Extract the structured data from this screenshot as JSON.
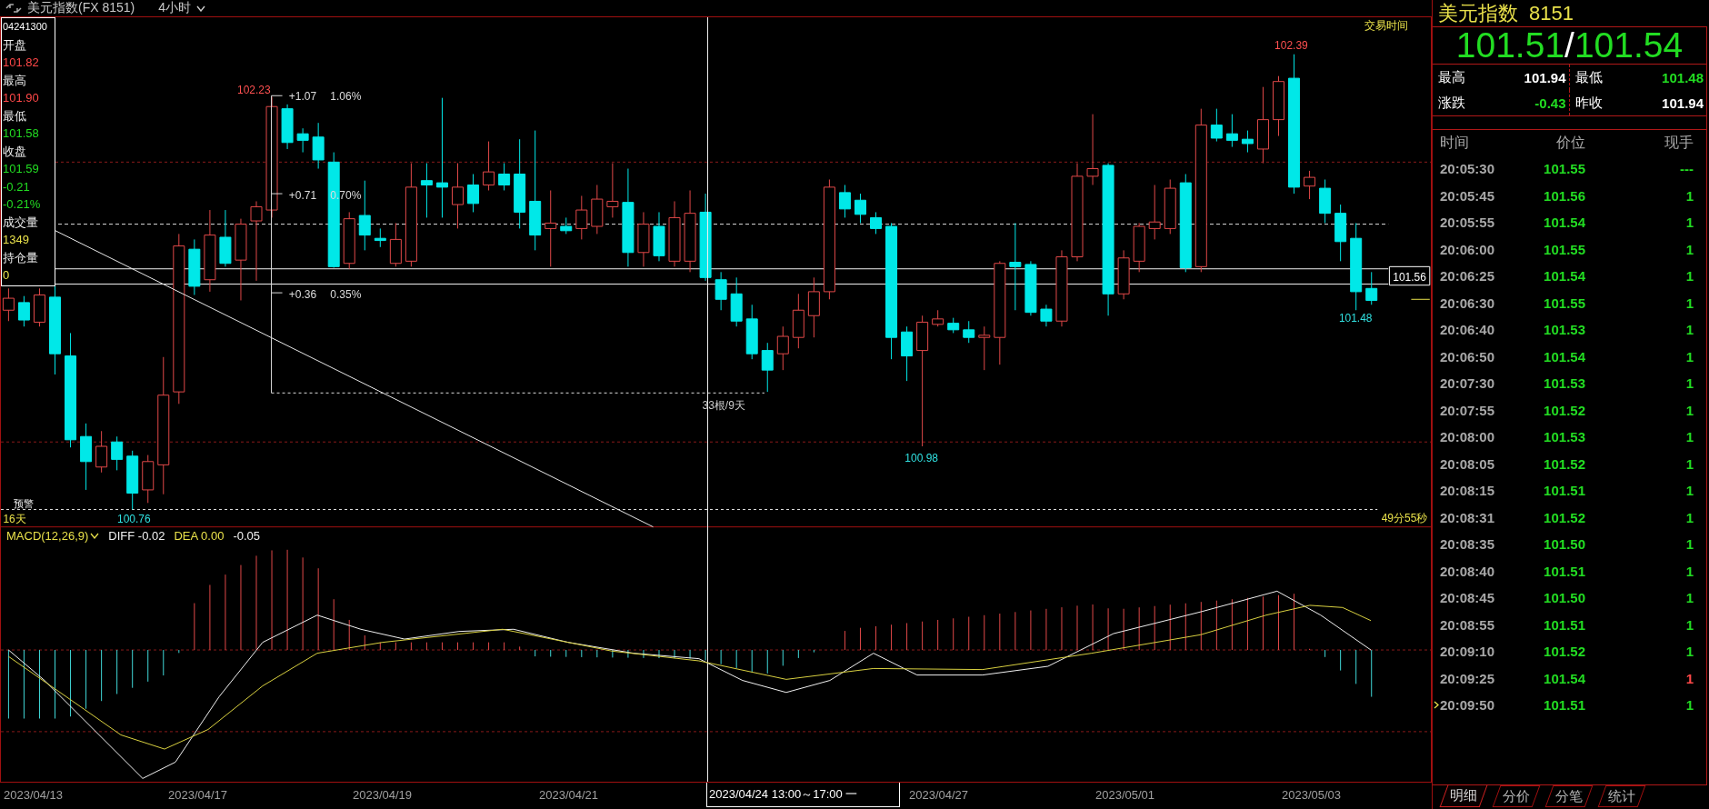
{
  "header": {
    "title": "美元指数(FX 8151)",
    "period": "4小时"
  },
  "info_box": {
    "date": "04241300",
    "fields": [
      {
        "label": "开盘",
        "value": "101.82",
        "kind": "up"
      },
      {
        "label": "最高",
        "value": "101.90",
        "kind": "up"
      },
      {
        "label": "最低",
        "value": "101.58",
        "kind": "down"
      },
      {
        "label": "收盘",
        "value": "101.59",
        "kind": "down"
      },
      {
        "value": "-0.21",
        "kind": "down"
      },
      {
        "value": "-0.21%",
        "kind": "down"
      },
      {
        "label": "成交量",
        "value": "1349",
        "kind": "volume"
      },
      {
        "label": "持仓量",
        "value": "0",
        "kind": "volume"
      }
    ]
  },
  "chart": {
    "corner_label": "交易时间",
    "price_labels": [
      {
        "text": "102.23",
        "kind": "high"
      },
      {
        "text": "102.39",
        "kind": "high"
      },
      {
        "text": "101.48",
        "kind": "low"
      },
      {
        "text": "100.98",
        "kind": "low"
      },
      {
        "text": "100.76",
        "kind": "low"
      }
    ],
    "measure_labels": [
      {
        "change": "+1.07",
        "percent": "1.06%"
      },
      {
        "change": "+0.71",
        "percent": "0.70%"
      },
      {
        "change": "+0.36",
        "percent": "0.35%"
      }
    ],
    "span_label": "33根/9天",
    "price_tag": "101.56",
    "alert_label": "预警",
    "days_label": "16天",
    "countdown": "49分55秒"
  },
  "macd": {
    "name": "MACD(12,26,9)",
    "values": [
      {
        "label": "DIFF",
        "value": "-0.02",
        "kind": "diff"
      },
      {
        "label": "DEA",
        "value": "0.00",
        "kind": "dea"
      },
      {
        "value": "-0.05",
        "kind": "macd"
      }
    ]
  },
  "x_axis": {
    "labels": [
      "2023/04/13",
      "2023/04/17",
      "2023/04/19",
      "2023/04/21",
      "2023/04/27",
      "2023/05/01",
      "2023/05/03"
    ],
    "cursor_label": "2023/04/24 13:00～17:00 一"
  },
  "quote": {
    "name": "美元指数",
    "code": "8151",
    "bid": "101.51",
    "separator": "/",
    "ask": "101.54",
    "stats": [
      {
        "label": "最高",
        "value": "101.94",
        "kind": "flat"
      },
      {
        "label": "最低",
        "value": "101.48",
        "kind": "down"
      },
      {
        "label": "涨跌",
        "value": "-0.43",
        "kind": "down"
      },
      {
        "label": "昨收",
        "value": "101.94",
        "kind": "flat"
      }
    ],
    "columns": [
      "时间",
      "价位",
      "现手"
    ],
    "ticks": [
      {
        "time": "20:05:30",
        "price": "101.55",
        "volume": "---",
        "kind": "sell",
        "selected": false
      },
      {
        "time": "20:05:45",
        "price": "101.56",
        "volume": "1",
        "kind": "sell",
        "selected": false
      },
      {
        "time": "20:05:55",
        "price": "101.54",
        "volume": "1",
        "kind": "sell",
        "selected": false
      },
      {
        "time": "20:06:00",
        "price": "101.55",
        "volume": "1",
        "kind": "sell",
        "selected": false
      },
      {
        "time": "20:06:25",
        "price": "101.54",
        "volume": "1",
        "kind": "sell",
        "selected": false
      },
      {
        "time": "20:06:30",
        "price": "101.55",
        "volume": "1",
        "kind": "sell",
        "selected": false
      },
      {
        "time": "20:06:40",
        "price": "101.53",
        "volume": "1",
        "kind": "sell",
        "selected": false
      },
      {
        "time": "20:06:50",
        "price": "101.54",
        "volume": "1",
        "kind": "sell",
        "selected": false
      },
      {
        "time": "20:07:30",
        "price": "101.53",
        "volume": "1",
        "kind": "sell",
        "selected": false
      },
      {
        "time": "20:07:55",
        "price": "101.52",
        "volume": "1",
        "kind": "sell",
        "selected": false
      },
      {
        "time": "20:08:00",
        "price": "101.53",
        "volume": "1",
        "kind": "sell",
        "selected": false
      },
      {
        "time": "20:08:05",
        "price": "101.52",
        "volume": "1",
        "kind": "sell",
        "selected": false
      },
      {
        "time": "20:08:15",
        "price": "101.51",
        "volume": "1",
        "kind": "sell",
        "selected": false
      },
      {
        "time": "20:08:31",
        "price": "101.52",
        "volume": "1",
        "kind": "sell",
        "selected": false
      },
      {
        "time": "20:08:35",
        "price": "101.50",
        "volume": "1",
        "kind": "sell",
        "selected": false
      },
      {
        "time": "20:08:40",
        "price": "101.51",
        "volume": "1",
        "kind": "sell",
        "selected": false
      },
      {
        "time": "20:08:45",
        "price": "101.50",
        "volume": "1",
        "kind": "sell",
        "selected": false
      },
      {
        "time": "20:08:55",
        "price": "101.51",
        "volume": "1",
        "kind": "sell",
        "selected": false
      },
      {
        "time": "20:09:10",
        "price": "101.52",
        "volume": "1",
        "kind": "sell",
        "selected": false
      },
      {
        "time": "20:09:25",
        "price": "101.54",
        "volume": "1",
        "kind": "buy",
        "selected": false
      },
      {
        "time": "20:09:50",
        "price": "101.51",
        "volume": "1",
        "kind": "sell",
        "selected": true
      }
    ],
    "tabs": [
      {
        "label": "明细",
        "selected": true
      },
      {
        "label": "分价",
        "selected": false
      },
      {
        "label": "分笔",
        "selected": false
      },
      {
        "label": "统计",
        "selected": false
      }
    ]
  }
}
